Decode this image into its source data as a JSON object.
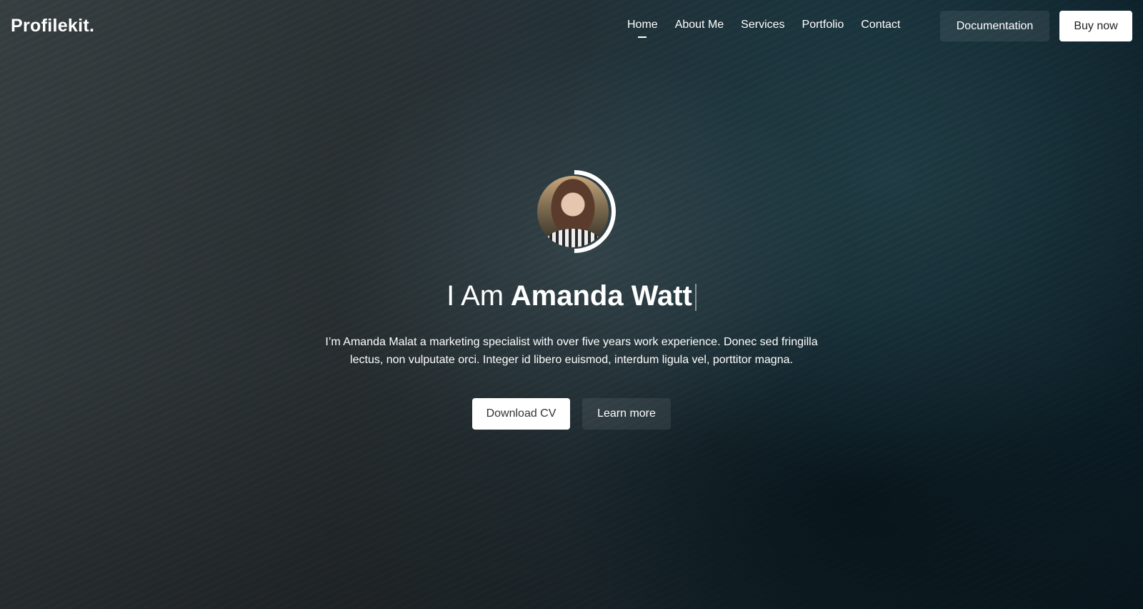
{
  "header": {
    "logo": "Profilekit.",
    "nav": [
      "Home",
      "About Me",
      "Services",
      "Portfolio",
      "Contact"
    ],
    "active_nav": "Home",
    "documentation_label": "Documentation",
    "buy_label": "Buy now"
  },
  "hero": {
    "title_prefix": "I Am",
    "title_name": "Amanda Watt",
    "description_line1": "I’m Amanda Malat a marketing specialist with over five years work experience. Donec sed fringilla",
    "description_line2": "lectus, non vulputate orci. Integer id libero euismod, interdum ligula vel, porttitor magna.",
    "download_label": "Download CV",
    "learn_label": "Learn more"
  },
  "colors": {
    "primary_text": "#ffffff",
    "button_light": "#ffffff",
    "button_dark": "rgba(255,255,255,0.08)"
  }
}
